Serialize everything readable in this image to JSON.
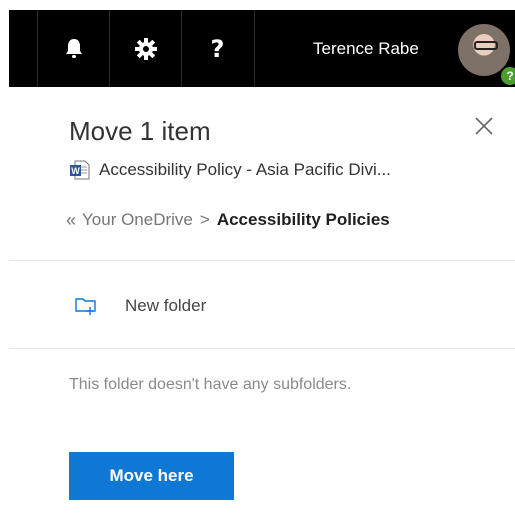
{
  "header": {
    "icons": [
      "bell-icon",
      "gear-icon",
      "help-icon"
    ],
    "help_glyph": "?",
    "user_name": "Terence Rabe",
    "presence_glyph": "?"
  },
  "dialog": {
    "title": "Move 1 item",
    "file_icon": "word-document-icon",
    "file_name": "Accessibility Policy - Asia Pacific Divi...",
    "breadcrumb": {
      "back_glyph": "«",
      "root": "Your OneDrive",
      "separator": ">",
      "current": "Accessibility Policies"
    },
    "new_folder_label": "New folder",
    "empty_message": "This folder doesn't have any subfolders.",
    "move_button_label": "Move here"
  },
  "colors": {
    "topbar": "#000000",
    "accent": "#0f78d4",
    "presence": "#4a9d2e"
  }
}
